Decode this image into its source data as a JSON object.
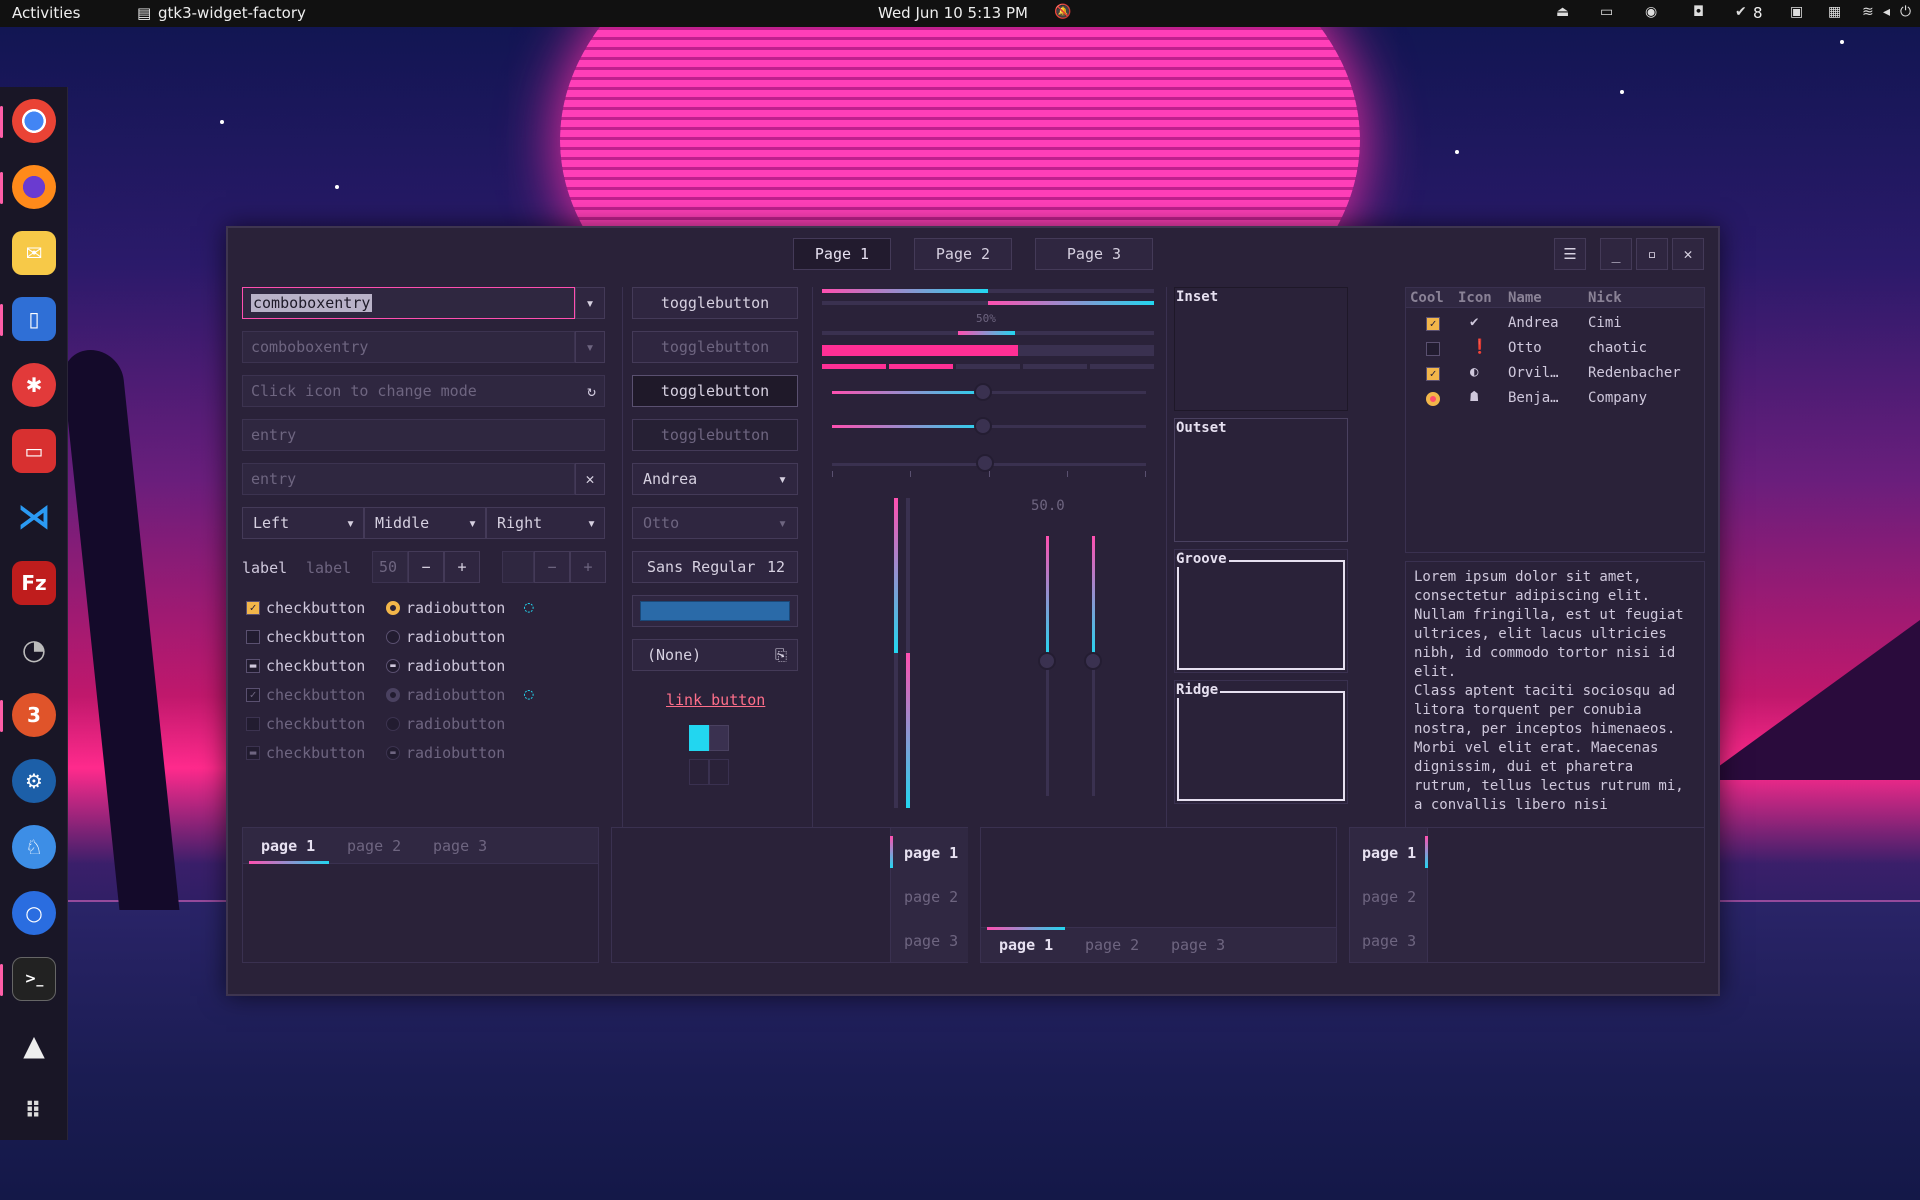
{
  "topbar": {
    "activities": "Activities",
    "app_name": "gtk3-widget-factory",
    "clock": "Wed Jun 10  5:13 PM",
    "updates_count": "8"
  },
  "window": {
    "tabs": [
      "Page 1",
      "Page 2",
      "Page 3"
    ],
    "left": {
      "combo1_value": "comboboxentry",
      "combo2_placeholder": "comboboxentry",
      "mode_entry_placeholder": "Click icon to change mode",
      "entry1_placeholder": "entry",
      "entry2_placeholder": "entry",
      "segments": [
        "Left",
        "Middle",
        "Right"
      ],
      "label1": "label",
      "label2": "label",
      "spin_value": "50",
      "checkbox_label": "checkbutton",
      "radio_label": "radiobutton"
    },
    "middle": {
      "toggle_label": "togglebutton",
      "combo1": "Andrea",
      "combo2": "Otto",
      "font_name": "Sans Regular",
      "font_size": "12",
      "file_chooser": "(None)",
      "link_button": "link button"
    },
    "sliders": {
      "progress_label": "50%",
      "scale_value": "50.0",
      "progress_fraction": 0.5
    },
    "frames": {
      "inset": "Inset",
      "outset": "Outset",
      "groove": "Groove",
      "ridge": "Ridge"
    },
    "tree": {
      "headers": [
        "Cool",
        "Icon",
        "Name",
        "Nick"
      ],
      "rows": [
        {
          "name": "Andrea",
          "nick": "Cimi",
          "cool": "checked"
        },
        {
          "name": "Otto",
          "nick": "chaotic",
          "cool": "unchecked"
        },
        {
          "name": "Orvil…",
          "nick": "Redenbacher",
          "cool": "checked"
        },
        {
          "name": "Benja…",
          "nick": "Company",
          "cool": "radio"
        }
      ]
    },
    "textview": "Lorem ipsum dolor sit amet, consectetur adipiscing elit. Nullam fringilla, est ut feugiat ultrices, elit lacus ultricies nibh, id commodo tortor nisi id elit.\nClass aptent taciti sociosqu ad litora torquent per conubia nostra, per inceptos himenaeos. Morbi vel elit erat. Maecenas dignissim, dui et pharetra rutrum, tellus lectus rutrum mi, a convallis libero nisi",
    "notebook_tabs": [
      "page 1",
      "page 2",
      "page 3"
    ]
  },
  "colors": {
    "accent_pink": "#ff4fb0",
    "accent_cyan": "#22d6f0",
    "window_bg": "#2a2239"
  }
}
